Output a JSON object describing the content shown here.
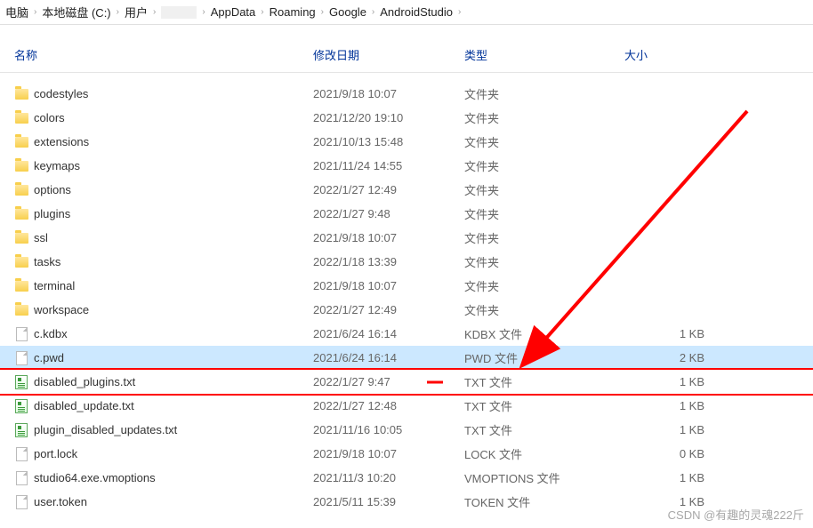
{
  "breadcrumb": [
    "电脑",
    "本地磁盘 (C:)",
    "用户",
    "",
    "AppData",
    "Roaming",
    "Google",
    "AndroidStudio"
  ],
  "columns": {
    "name": "名称",
    "date": "修改日期",
    "type": "类型",
    "size": "大小"
  },
  "rows": [
    {
      "icon": "folder",
      "name": "codestyles",
      "date": "2021/9/18 10:07",
      "type": "文件夹",
      "size": ""
    },
    {
      "icon": "folder",
      "name": "colors",
      "date": "2021/12/20 19:10",
      "type": "文件夹",
      "size": ""
    },
    {
      "icon": "folder",
      "name": "extensions",
      "date": "2021/10/13 15:48",
      "type": "文件夹",
      "size": ""
    },
    {
      "icon": "folder",
      "name": "keymaps",
      "date": "2021/11/24 14:55",
      "type": "文件夹",
      "size": ""
    },
    {
      "icon": "folder",
      "name": "options",
      "date": "2022/1/27 12:49",
      "type": "文件夹",
      "size": ""
    },
    {
      "icon": "folder",
      "name": "plugins",
      "date": "2022/1/27 9:48",
      "type": "文件夹",
      "size": ""
    },
    {
      "icon": "folder",
      "name": "ssl",
      "date": "2021/9/18 10:07",
      "type": "文件夹",
      "size": ""
    },
    {
      "icon": "folder",
      "name": "tasks",
      "date": "2022/1/18 13:39",
      "type": "文件夹",
      "size": ""
    },
    {
      "icon": "folder",
      "name": "terminal",
      "date": "2021/9/18 10:07",
      "type": "文件夹",
      "size": ""
    },
    {
      "icon": "folder",
      "name": "workspace",
      "date": "2022/1/27 12:49",
      "type": "文件夹",
      "size": ""
    },
    {
      "icon": "file",
      "name": "c.kdbx",
      "date": "2021/6/24 16:14",
      "type": "KDBX 文件",
      "size": "1 KB"
    },
    {
      "icon": "file",
      "name": "c.pwd",
      "date": "2021/6/24 16:14",
      "type": "PWD 文件",
      "size": "2 KB",
      "selected": true
    },
    {
      "icon": "txt",
      "name": "disabled_plugins.txt",
      "date": "2022/1/27 9:47",
      "type": "TXT 文件",
      "size": "1 KB",
      "highlighted": true,
      "red_dash": true
    },
    {
      "icon": "txt",
      "name": "disabled_update.txt",
      "date": "2022/1/27 12:48",
      "type": "TXT 文件",
      "size": "1 KB"
    },
    {
      "icon": "txt",
      "name": "plugin_disabled_updates.txt",
      "date": "2021/11/16 10:05",
      "type": "TXT 文件",
      "size": "1 KB"
    },
    {
      "icon": "file",
      "name": "port.lock",
      "date": "2021/9/18 10:07",
      "type": "LOCK 文件",
      "size": "0 KB"
    },
    {
      "icon": "file",
      "name": "studio64.exe.vmoptions",
      "date": "2021/11/3 10:20",
      "type": "VMOPTIONS 文件",
      "size": "1 KB"
    },
    {
      "icon": "file",
      "name": "user.token",
      "date": "2021/5/11 15:39",
      "type": "TOKEN 文件",
      "size": "1 KB"
    }
  ],
  "watermark": "CSDN @有趣的灵魂222斤"
}
